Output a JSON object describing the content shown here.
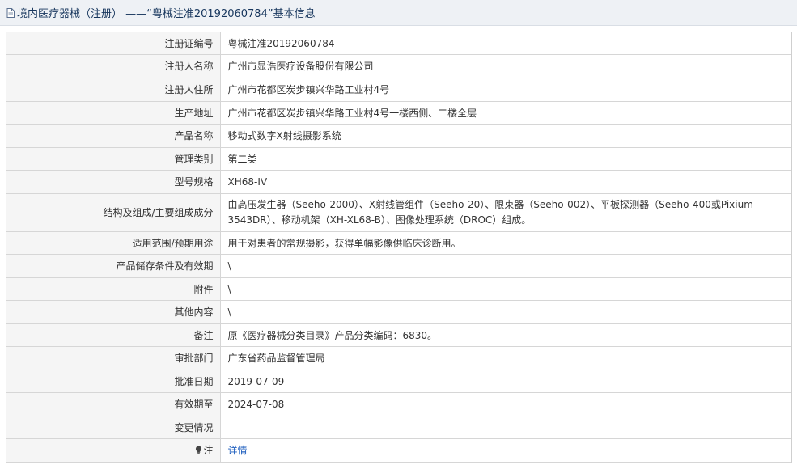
{
  "header": {
    "title": "境内医疗器械（注册）  ——“粤械注准20192060784”基本信息"
  },
  "rows": [
    {
      "label": "注册证编号",
      "value": "粤械注准20192060784"
    },
    {
      "label": "注册人名称",
      "value": "广州市显浩医疗设备股份有限公司"
    },
    {
      "label": "注册人住所",
      "value": "广州市花都区炭步镇兴华路工业村4号"
    },
    {
      "label": "生产地址",
      "value": "广州市花都区炭步镇兴华路工业村4号一楼西侧、二楼全层"
    },
    {
      "label": "产品名称",
      "value": "移动式数字X射线摄影系统"
    },
    {
      "label": "管理类别",
      "value": "第二类"
    },
    {
      "label": "型号规格",
      "value": "XH68-IV"
    },
    {
      "label": "结构及组成/主要组成成分",
      "value": "由高压发生器（Seeho-2000）、X射线管组件（Seeho-20）、限束器（Seeho-002）、平板探测器（Seeho-400或Pixium 3543DR）、移动机架（XH-XL68-B）、图像处理系统（DROC）组成。"
    },
    {
      "label": "适用范围/预期用途",
      "value": "用于对患者的常规摄影，获得单幅影像供临床诊断用。"
    },
    {
      "label": "产品储存条件及有效期",
      "value": "\\"
    },
    {
      "label": "附件",
      "value": "\\"
    },
    {
      "label": "其他内容",
      "value": "\\"
    },
    {
      "label": "备注",
      "value": "原《医疗器械分类目录》产品分类编码：6830。"
    },
    {
      "label": "审批部门",
      "value": "广东省药品监督管理局"
    },
    {
      "label": "批准日期",
      "value": "2019-07-09"
    },
    {
      "label": "有效期至",
      "value": "2024-07-08"
    },
    {
      "label": "变更情况",
      "value": ""
    },
    {
      "label": "注",
      "value": "详情"
    }
  ]
}
